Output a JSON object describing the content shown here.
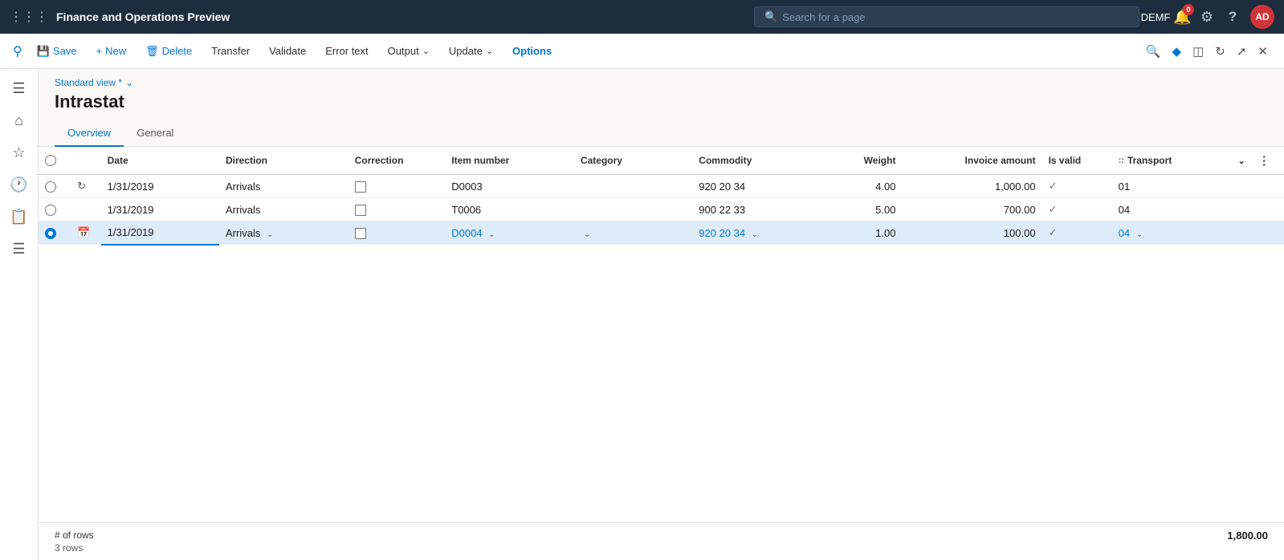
{
  "topnav": {
    "apps_icon": "⊞",
    "title": "Finance and Operations Preview",
    "search_placeholder": "Search for a page",
    "user_company": "DEMF",
    "user_initials": "AD",
    "notification_count": "0",
    "icons": {
      "notification": "🔔",
      "settings": "⚙",
      "help": "?",
      "bookmark": "🔖",
      "split": "⬜",
      "refresh": "↺",
      "popout": "⤢",
      "close": "✕"
    }
  },
  "cmdbar": {
    "save": "Save",
    "new": "New",
    "delete": "Delete",
    "transfer": "Transfer",
    "validate": "Validate",
    "error_text": "Error text",
    "output": "Output",
    "update": "Update",
    "options": "Options"
  },
  "sidebar": {
    "icons": [
      "☰",
      "🏠",
      "★",
      "🕐",
      "📋",
      "≡"
    ]
  },
  "page": {
    "view_label": "Standard view *",
    "title": "Intrastat",
    "tabs": [
      {
        "label": "Overview",
        "active": true
      },
      {
        "label": "General",
        "active": false
      }
    ]
  },
  "table": {
    "columns": [
      {
        "key": "check",
        "label": ""
      },
      {
        "key": "refresh",
        "label": ""
      },
      {
        "key": "date",
        "label": "Date"
      },
      {
        "key": "direction",
        "label": "Direction"
      },
      {
        "key": "correction",
        "label": "Correction"
      },
      {
        "key": "itemnumber",
        "label": "Item number"
      },
      {
        "key": "category",
        "label": "Category"
      },
      {
        "key": "commodity",
        "label": "Commodity"
      },
      {
        "key": "weight",
        "label": "Weight"
      },
      {
        "key": "invoiceamt",
        "label": "Invoice amount"
      },
      {
        "key": "isvalid",
        "label": "Is valid"
      },
      {
        "key": "transport",
        "label": "Transport"
      },
      {
        "key": "dots",
        "label": ""
      }
    ],
    "rows": [
      {
        "selected": false,
        "date": "1/31/2019",
        "direction": "Arrivals",
        "correction": false,
        "itemnumber": "D0003",
        "itemnumber_link": false,
        "category": "",
        "commodity": "920 20 34",
        "weight": "4.00",
        "invoiceamt": "1,000.00",
        "isvalid": true,
        "transport": "01",
        "editing": false
      },
      {
        "selected": false,
        "date": "1/31/2019",
        "direction": "Arrivals",
        "correction": false,
        "itemnumber": "T0006",
        "itemnumber_link": false,
        "category": "",
        "commodity": "900 22 33",
        "weight": "5.00",
        "invoiceamt": "700.00",
        "isvalid": true,
        "transport": "04",
        "editing": false
      },
      {
        "selected": true,
        "date": "1/31/2019",
        "direction": "Arrivals",
        "correction": false,
        "itemnumber": "D0004",
        "itemnumber_link": true,
        "category": "",
        "commodity": "920 20 34",
        "weight": "1.00",
        "invoiceamt": "100.00",
        "isvalid": true,
        "transport": "04",
        "editing": true
      }
    ]
  },
  "footer": {
    "rows_label": "# of rows",
    "rows_count": "3 rows",
    "total": "1,800.00"
  }
}
